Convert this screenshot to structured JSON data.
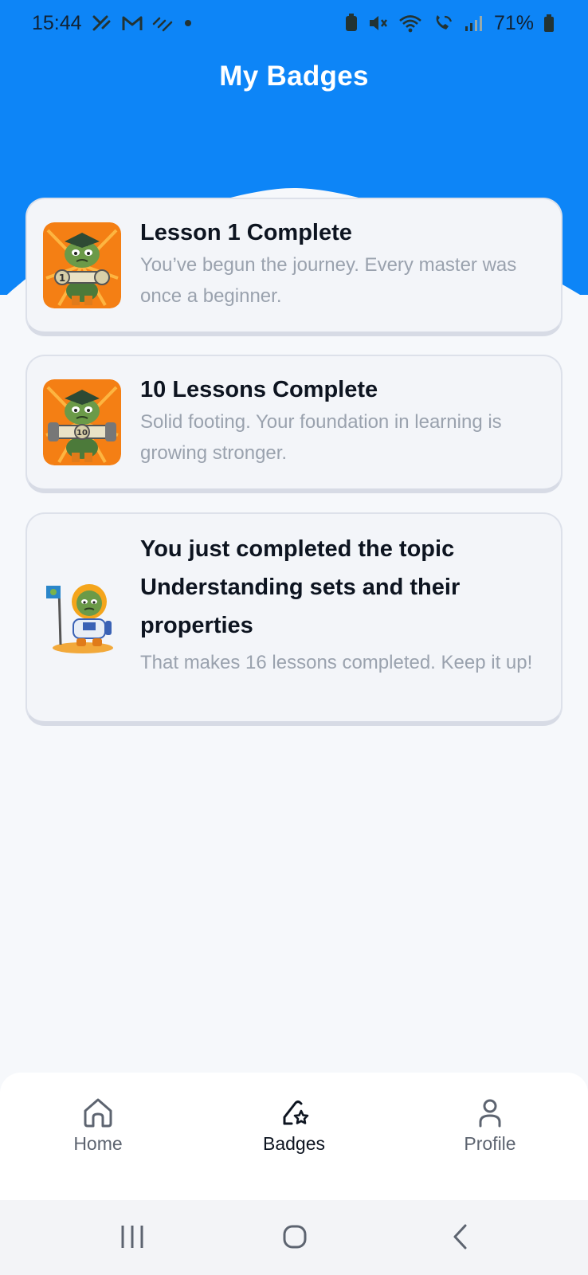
{
  "status_bar": {
    "time": "15:44",
    "battery": "71%"
  },
  "header": {
    "title": "My Badges",
    "background_color": "#0d85f7"
  },
  "badges": [
    {
      "title": "Lesson 1 Complete",
      "description": "You’ve begun the journey. Every master was once a beginner.",
      "icon": "frog-graduate-dumbbell-1-badge",
      "dumbbell_label": "1"
    },
    {
      "title": "10 Lessons Complete",
      "description": "Solid footing. Your foundation in learning is growing stronger.",
      "icon": "frog-graduate-dumbbell-10-badge",
      "dumbbell_label": "10"
    },
    {
      "title": "You just completed the topic Understanding sets and their properties",
      "description": "That makes 16 lessons completed. Keep it up!",
      "icon": "frog-astronaut-flag-badge"
    }
  ],
  "bottom_nav": {
    "items": [
      {
        "label": "Home",
        "icon": "home-icon",
        "active": false
      },
      {
        "label": "Badges",
        "icon": "badge-star-icon",
        "active": true
      },
      {
        "label": "Profile",
        "icon": "profile-icon",
        "active": false
      }
    ]
  },
  "system_nav": {
    "buttons": [
      "recents-icon",
      "home-circle-icon",
      "back-icon"
    ]
  }
}
